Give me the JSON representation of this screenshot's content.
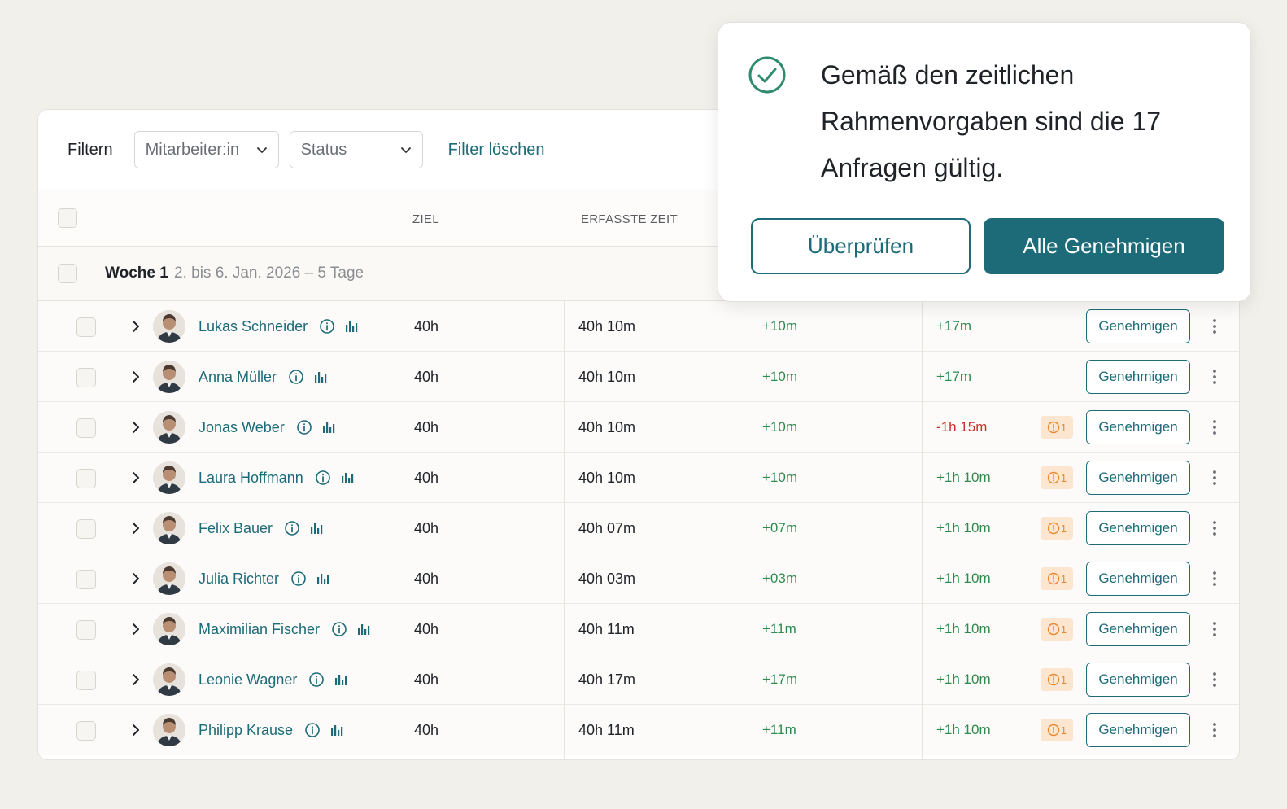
{
  "filters": {
    "label": "Filtern",
    "employee_select": "Mitarbeiter:in",
    "status_select": "Status",
    "clear": "Filter löschen"
  },
  "columns": {
    "goal": "ZIEL",
    "recorded": "ERFASSTE ZEIT"
  },
  "week": {
    "title": "Woche 1",
    "subtitle": "2. bis 6. Jan. 2026 – 5 Tage"
  },
  "approve_label": "Genehmigen",
  "rows": [
    {
      "name": "Lukas Schneider",
      "goal": "40h",
      "recorded": "40h 10m",
      "diff": "+10m",
      "balance": "+17m",
      "balance_state": "pos",
      "warning": null
    },
    {
      "name": "Anna Müller",
      "goal": "40h",
      "recorded": "40h 10m",
      "diff": "+10m",
      "balance": "+17m",
      "balance_state": "pos",
      "warning": null
    },
    {
      "name": "Jonas Weber",
      "goal": "40h",
      "recorded": "40h 10m",
      "diff": "+10m",
      "balance": "-1h 15m",
      "balance_state": "neg",
      "warning": "1"
    },
    {
      "name": "Laura Hoffmann",
      "goal": "40h",
      "recorded": "40h 10m",
      "diff": "+10m",
      "balance": "+1h 10m",
      "balance_state": "pos",
      "warning": "1"
    },
    {
      "name": "Felix Bauer",
      "goal": "40h",
      "recorded": "40h 07m",
      "diff": "+07m",
      "balance": "+1h 10m",
      "balance_state": "pos",
      "warning": "1"
    },
    {
      "name": "Julia Richter",
      "goal": "40h",
      "recorded": "40h 03m",
      "diff": "+03m",
      "balance": "+1h 10m",
      "balance_state": "pos",
      "warning": "1"
    },
    {
      "name": "Maximilian Fischer",
      "goal": "40h",
      "recorded": "40h 11m",
      "diff": "+11m",
      "balance": "+1h 10m",
      "balance_state": "pos",
      "warning": "1"
    },
    {
      "name": "Leonie Wagner",
      "goal": "40h",
      "recorded": "40h 17m",
      "diff": "+17m",
      "balance": "+1h 10m",
      "balance_state": "pos",
      "warning": "1"
    },
    {
      "name": "Philipp Krause",
      "goal": "40h",
      "recorded": "40h 11m",
      "diff": "+11m",
      "balance": "+1h 10m",
      "balance_state": "pos",
      "warning": "1"
    }
  ],
  "popup": {
    "message": "Gemäß den zeitlichen Rahmenvorgaben sind die 17 Anfragen gültig.",
    "review": "Überprüfen",
    "approve_all": "Alle Genehmigen"
  },
  "colors": {
    "accent": "#1d6b78",
    "positive": "#2e8b4e",
    "negative": "#c9302c",
    "warning": "#e8892f",
    "warning_bg": "#fde6cf"
  },
  "icons": {
    "row": [
      "chevron-right-icon",
      "avatar",
      "info-icon",
      "bar-chart-icon",
      "warning-icon",
      "more-vertical-icon"
    ],
    "popup": "check-circle-icon"
  }
}
